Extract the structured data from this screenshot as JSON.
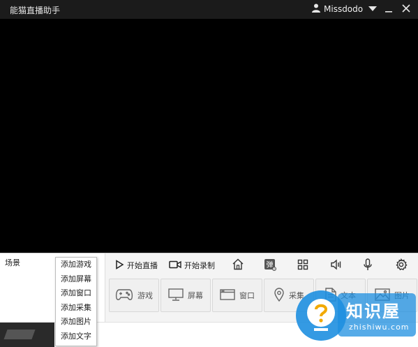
{
  "app": {
    "title": "能猫直播助手",
    "user_name": "Missdodo"
  },
  "scene_panel": {
    "label": "场景"
  },
  "toolbar": {
    "start_live": "开始直播",
    "start_record": "开始录制"
  },
  "sources": {
    "game": "游戏",
    "screen": "屏幕",
    "window": "窗口",
    "capture": "采集",
    "text": "文本",
    "image": "图片"
  },
  "add_menu": {
    "items": [
      "添加游戏",
      "添加屏幕",
      "添加窗口",
      "添加采集",
      "添加图片",
      "添加文字"
    ]
  },
  "watermark": {
    "title": "知识屋",
    "subtitle": "zhishiwu.com"
  },
  "icons": {
    "user": "user-icon",
    "dropdown": "chevron-down-icon",
    "minimize": "minimize-icon",
    "close": "close-icon",
    "play": "play-icon",
    "record": "video-camera-icon",
    "home": "home-icon",
    "danmaku": "danmaku-icon",
    "grid": "grid-icon",
    "volume": "speaker-icon",
    "mic": "microphone-icon",
    "settings": "gear-icon"
  },
  "colors": {
    "titlebar": "#1b1b1b",
    "preview": "#000000",
    "watermark_blue": "#1e8fe0"
  }
}
